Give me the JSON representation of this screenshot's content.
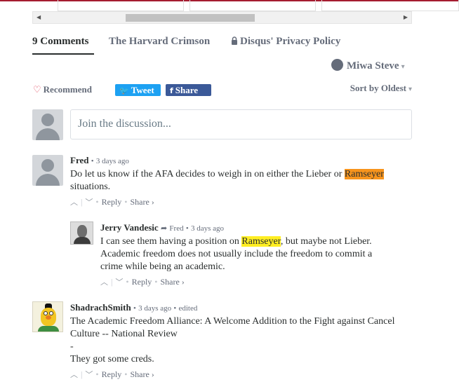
{
  "nav": {
    "comments_tab": "9 Comments",
    "site_tab": "The Harvard Crimson",
    "privacy_tab": "Disqus' Privacy Policy"
  },
  "user": {
    "name": "Miwa Steve"
  },
  "actions": {
    "recommend": "Recommend",
    "tweet": "Tweet",
    "share": "Share",
    "sort": "Sort by Oldest"
  },
  "composer": {
    "placeholder": "Join the discussion..."
  },
  "comments": [
    {
      "author": "Fred",
      "meta": "3 days ago",
      "text_before": "Do let us know if the AFA decides to weigh in on either the Lieber or ",
      "highlight": "Ramseyer",
      "text_after": " situations.",
      "reply": "Reply",
      "share": "Share ›"
    },
    {
      "author": "Jerry Vandesic",
      "reply_to": "Fred",
      "meta": "3 days ago",
      "text_before": "I can see them having a position on ",
      "highlight": "Ramseyer",
      "text_after": ", but maybe not Lieber. Academic freedom does not usually include the freedom to commit a crime while being an academic.",
      "reply": "Reply",
      "share": "Share ›"
    },
    {
      "author": "ShadrachSmith",
      "meta": "3 days ago",
      "edited": "edited",
      "line1": "The Academic Freedom Alliance: A Welcome Addition to the Fight against Cancel Culture -- National Review",
      "line2": "-",
      "line3": "They got some creds.",
      "reply": "Reply",
      "share": "Share ›"
    }
  ],
  "colors": {
    "tweet_bg": "#1da1f2",
    "facebook_bg": "#3b5998",
    "highlight_orange": "#f7941d",
    "highlight_yellow": "#ffee22",
    "brand_red": "#a51c30"
  }
}
